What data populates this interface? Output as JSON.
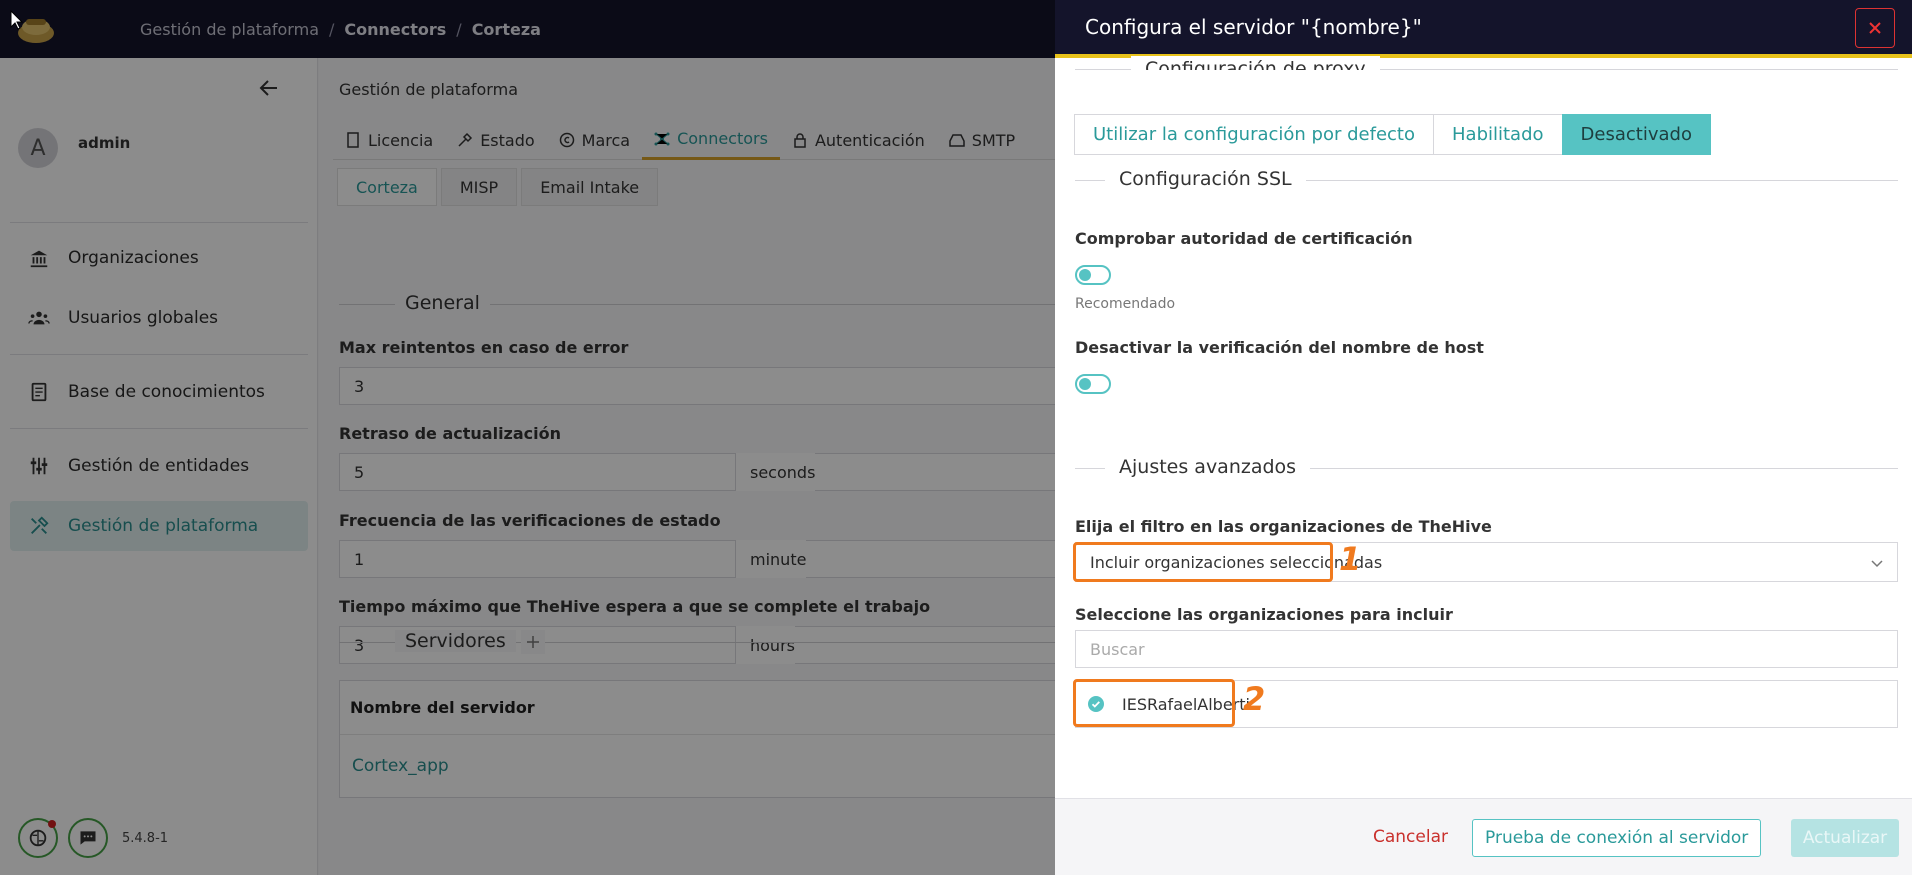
{
  "topbar": {
    "breadcrumbs": [
      "Gestión de plataforma",
      "Connectors",
      "Corteza"
    ],
    "separator": "/"
  },
  "sidebar": {
    "user": {
      "initial": "A",
      "name": "admin"
    },
    "items": [
      {
        "label": "Organizaciones",
        "icon": "bank-icon"
      },
      {
        "label": "Usuarios globales",
        "icon": "users-icon"
      },
      {
        "label": "Base de conocimientos",
        "icon": "book-icon"
      },
      {
        "label": "Gestión de entidades",
        "icon": "sliders-icon"
      },
      {
        "label": "Gestión de plataforma",
        "icon": "tools-icon",
        "active": true
      }
    ],
    "version": "5.4.8-1"
  },
  "main": {
    "title": "Gestión de plataforma",
    "tabs": [
      "Licencia",
      "Estado",
      "Marca",
      "Connectors",
      "Autenticación",
      "SMTP"
    ],
    "subtabs": [
      "Corteza",
      "MISP",
      "Email Intake"
    ],
    "general_title": "General",
    "fields": {
      "max_retries": {
        "label": "Max reintentos en caso de error",
        "value": "3"
      },
      "refresh_delay": {
        "label": "Retraso de actualización",
        "value": "5",
        "unit": "seconds"
      },
      "health_frequency": {
        "label": "Frecuencia de las verificaciones de estado",
        "value": "1",
        "unit": "minute"
      },
      "max_wait": {
        "label": "Tiempo máximo que TheHive espera a que se complete el trabajo",
        "value": "3",
        "unit": "hours"
      }
    },
    "servers_title": "Servidores",
    "table": {
      "header": "Nombre del servidor",
      "rows": [
        "Cortex_app"
      ]
    }
  },
  "drawer": {
    "title": "Configura el servidor \"{nombre}\"",
    "proxy_title": "Configuración de proxy",
    "proxy_options": [
      "Utilizar la configuración por defecto",
      "Habilitado",
      "Desactivado"
    ],
    "proxy_selected": "Desactivado",
    "ssl_title": "Configuración SSL",
    "check_ca": {
      "label": "Comprobar autoridad de certificación",
      "hint": "Recomendado"
    },
    "disable_hostname": {
      "label": "Desactivar la verificación del nombre de host"
    },
    "advanced_title": "Ajustes avanzados",
    "filter": {
      "label": "Elija el filtro en las organizaciones de TheHive",
      "value": "Incluir organizaciones seleccionadas"
    },
    "orgs": {
      "label": "Seleccione las organizaciones para incluir",
      "search_placeholder": "Buscar",
      "selected": [
        "IESRafaelAlberti"
      ]
    },
    "annotations": [
      "1",
      "2"
    ],
    "footer": {
      "cancel": "Cancelar",
      "test": "Prueba de conexión al servidor",
      "update": "Actualizar"
    }
  },
  "colors": {
    "accent": "#56c3c3",
    "header": "#14142b",
    "highlight": "#f07a1e",
    "danger": "#c9302c"
  }
}
